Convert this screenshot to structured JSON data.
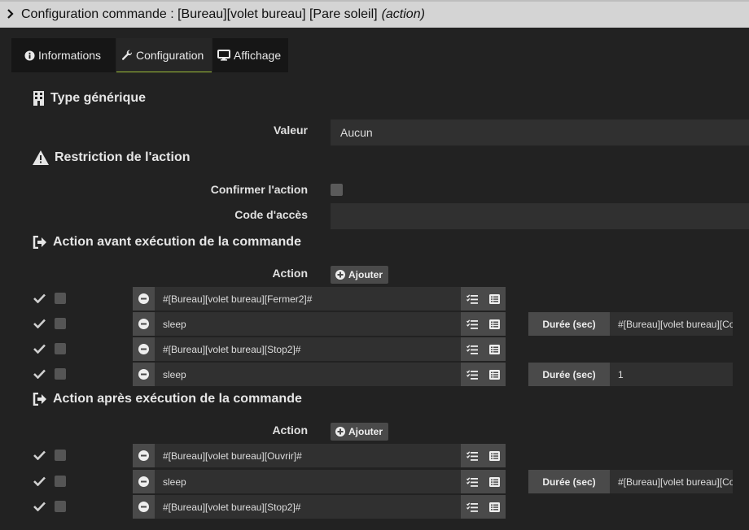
{
  "window": {
    "title": "Configuration commande : [Bureau][volet bureau] [Pare soleil]",
    "title_suffix": "(action)"
  },
  "tabs": [
    {
      "label": "Informations",
      "icon": "info-circle-icon"
    },
    {
      "label": "Configuration",
      "icon": "wrench-icon",
      "active": true
    },
    {
      "label": "Affichage",
      "icon": "desktop-icon"
    }
  ],
  "generic_type": {
    "heading": "Type générique",
    "valeur_label": "Valeur",
    "valeur_value": "Aucun"
  },
  "restriction": {
    "heading": "Restriction de l'action",
    "confirm_label": "Confirmer l'action",
    "code_label": "Code d'accès",
    "code_value": ""
  },
  "pre_action": {
    "heading": "Action avant exécution de la commande",
    "action_label": "Action",
    "add_label": "Ajouter",
    "rows": [
      {
        "cmd": "#[Bureau][volet bureau][Fermer2]#"
      },
      {
        "cmd": "sleep",
        "duration_label": "Durée (sec)",
        "duration_value": "#[Bureau][volet bureau][Coef Pare soleil]#"
      },
      {
        "cmd": "#[Bureau][volet bureau][Stop2]#"
      },
      {
        "cmd": "sleep",
        "duration_label": "Durée (sec)",
        "duration_value": "1"
      }
    ]
  },
  "post_action": {
    "heading": "Action après exécution de la commande",
    "action_label": "Action",
    "add_label": "Ajouter",
    "rows": [
      {
        "cmd": "#[Bureau][volet bureau][Ouvrir]#"
      },
      {
        "cmd": "sleep",
        "duration_label": "Durée (sec)",
        "duration_value": "#[Bureau][volet bureau][Coef Pare soleil]#"
      },
      {
        "cmd": "#[Bureau][volet bureau][Stop2]#"
      }
    ]
  }
}
